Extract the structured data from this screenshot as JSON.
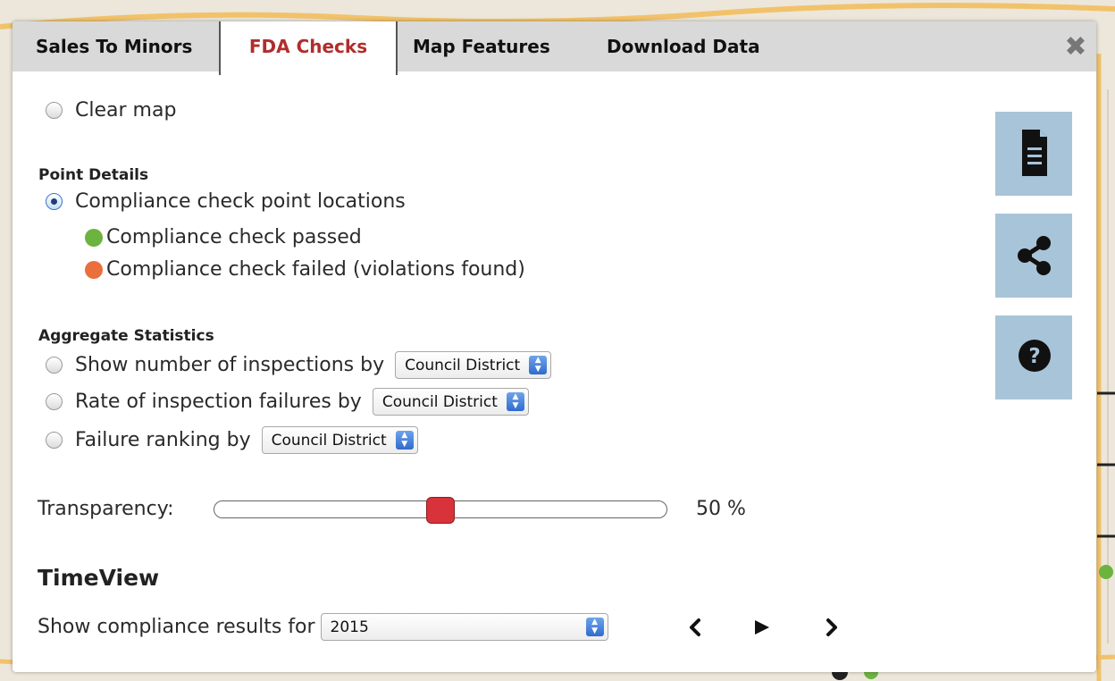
{
  "tabs": [
    {
      "label": "Sales To Minors",
      "active": false
    },
    {
      "label": "FDA Checks",
      "active": true
    },
    {
      "label": "Map Features",
      "active": false
    },
    {
      "label": "Download Data",
      "active": false
    }
  ],
  "close_icon": "close-icon",
  "clear_map": {
    "label": "Clear map",
    "checked": false
  },
  "point_details": {
    "heading": "Point Details",
    "option": {
      "label": "Compliance check point locations",
      "checked": true
    },
    "legend": [
      {
        "label": "Compliance check passed",
        "color": "#6db33f"
      },
      {
        "label": "Compliance check failed (violations found)",
        "color": "#ea6f3c"
      }
    ]
  },
  "aggregate": {
    "heading": "Aggregate Statistics",
    "options": [
      {
        "label": "Show number of inspections by",
        "checked": false,
        "select": "Council District"
      },
      {
        "label": "Rate of inspection failures by",
        "checked": false,
        "select": "Council District"
      },
      {
        "label": "Failure ranking by",
        "checked": false,
        "select": "Council District"
      }
    ]
  },
  "transparency": {
    "label": "Transparency:",
    "value_text": "50 %",
    "value": 0.5
  },
  "timeview": {
    "heading": "TimeView",
    "label": "Show compliance results for",
    "select": "2015",
    "icons": [
      "chevron-left-icon",
      "play-icon",
      "chevron-right-icon"
    ]
  },
  "side_buttons": [
    "document-icon",
    "share-icon",
    "help-icon"
  ],
  "colors": {
    "accent": "#b12d2d",
    "side_button": "#a8c4d8",
    "slider_thumb": "#d8323a"
  }
}
